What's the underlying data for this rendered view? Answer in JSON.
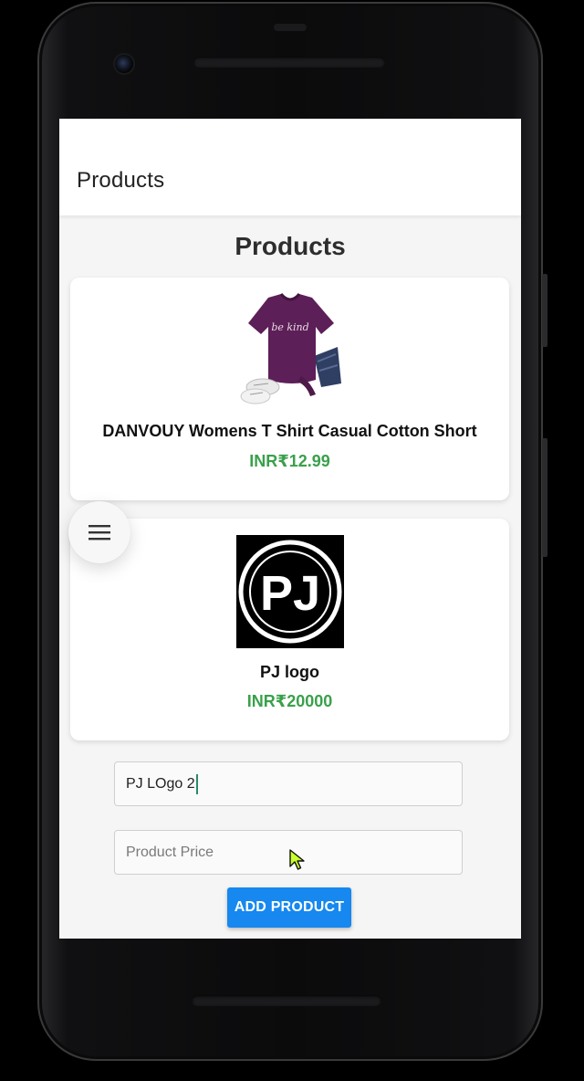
{
  "appbar": {
    "title": "Products"
  },
  "page": {
    "heading": "Products"
  },
  "products": [
    {
      "name": "DANVOUY Womens T Shirt Casual Cotton Short",
      "price": "INR₹12.99",
      "image": "purple-tshirt-image",
      "shirt_text": "be kind"
    },
    {
      "name": "PJ logo",
      "price": "INR₹20000",
      "image": "pj-logo-image",
      "logo_text": "PJ"
    }
  ],
  "form": {
    "name_value": "PJ LOgo 2",
    "price_placeholder": "Product Price",
    "add_button_label": "ADD PRODUCT"
  },
  "icons": {
    "menu": "hamburger-menu-icon",
    "cursor": "mouse-pointer-icon"
  },
  "colors": {
    "accent": "#1688ef",
    "price": "#3aa04a",
    "shirt": "#5d1f57"
  }
}
